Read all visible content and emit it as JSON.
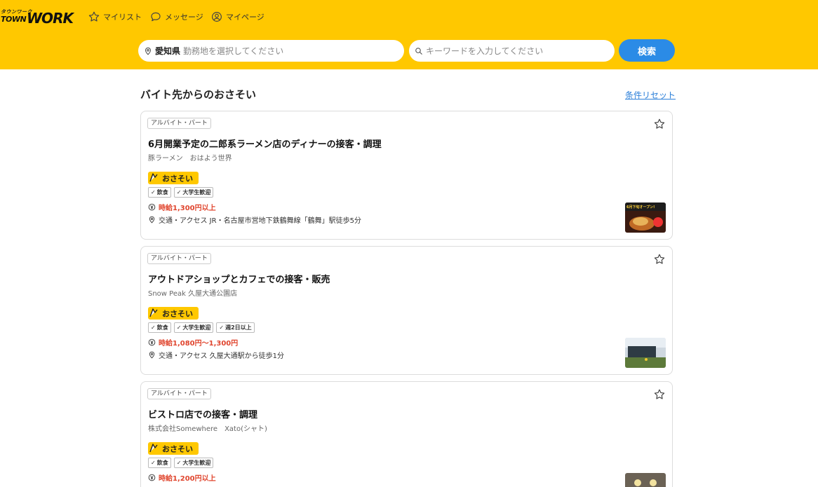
{
  "header": {
    "logo_kana": "タウンワーク",
    "logo_town": "TOWN",
    "logo_work": "WORK",
    "nav": [
      {
        "label": "マイリスト",
        "icon": "star-icon"
      },
      {
        "label": "メッセージ",
        "icon": "message-icon"
      },
      {
        "label": "マイページ",
        "icon": "user-icon"
      }
    ],
    "location": {
      "prefecture": "愛知県",
      "placeholder": "勤務地を選択してください"
    },
    "keyword": {
      "placeholder": "キーワードを入力してください"
    },
    "search_label": "検索",
    "brand_color": "#ffc800",
    "button_color": "#2b8be6"
  },
  "main": {
    "title": "バイト先からのおさそい",
    "reset_label": "条件リセット",
    "jobs": [
      {
        "type": "アルバイト・パート",
        "title": "6月開業予定の二郎系ラーメン店のディナーの接客・調理",
        "company": "豚ラーメン　おはよう世界",
        "osasoi": "おさそい",
        "badges": [
          "飲食",
          "大学生歓迎"
        ],
        "wage": "時給1,300円以上",
        "access": "交通・アクセス JR・名古屋市営地下鉄鶴舞線「鶴舞」駅徒歩5分",
        "thumb_text": "6月下旬オープン!"
      },
      {
        "type": "アルバイト・パート",
        "title": "アウトドアショップとカフェでの接客・販売",
        "company": "Snow Peak 久屋大通公園店",
        "osasoi": "おさそい",
        "badges": [
          "飲食",
          "大学生歓迎",
          "週2日以上"
        ],
        "wage": "時給1,080円〜1,300円",
        "access": "交通・アクセス 久屋大通駅から徒歩1分"
      },
      {
        "type": "アルバイト・パート",
        "title": "ビストロ店での接客・調理",
        "company": "株式会社Somewhere　Xato(シャト)",
        "osasoi": "おさそい",
        "badges": [
          "飲食",
          "大学生歓迎"
        ],
        "wage": "時給1,200円以上",
        "access": ""
      }
    ]
  }
}
